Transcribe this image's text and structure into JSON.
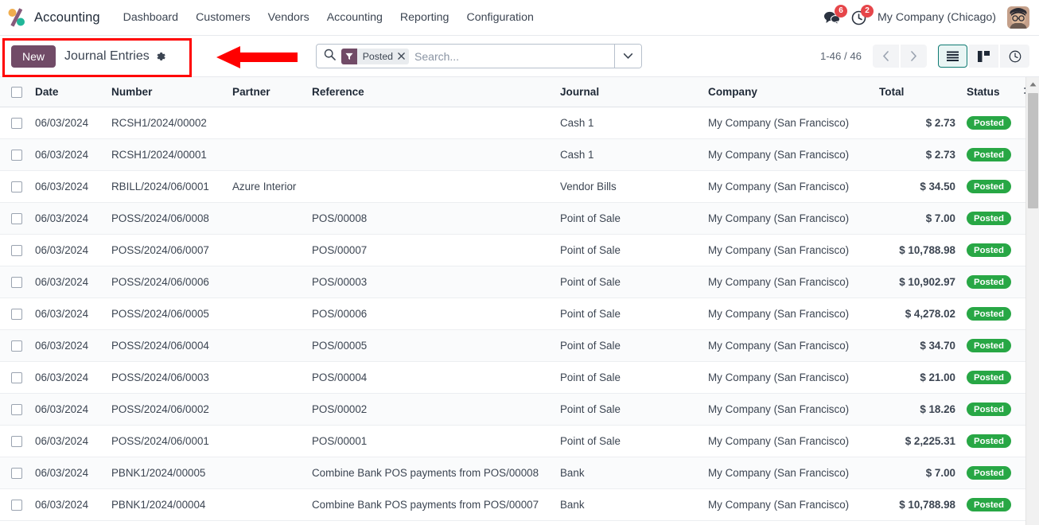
{
  "navbar": {
    "brand": "Accounting",
    "logo_colors": {
      "orange": "#f0ad4e",
      "purple": "#875a7b",
      "teal": "#21b799"
    },
    "menus": [
      {
        "label": "Dashboard"
      },
      {
        "label": "Customers"
      },
      {
        "label": "Vendors"
      },
      {
        "label": "Accounting"
      },
      {
        "label": "Reporting"
      },
      {
        "label": "Configuration"
      }
    ],
    "messages_badge": "6",
    "activities_badge": "2",
    "company": "My Company (Chicago)",
    "badge_color": "#e6464a"
  },
  "control_panel": {
    "new_button": "New",
    "title": "Journal Entries",
    "search": {
      "placeholder": "Search...",
      "facet_label": "Posted"
    },
    "pager": "1-46 / 46",
    "views": [
      {
        "name": "list",
        "active": true
      },
      {
        "name": "kanban",
        "active": false
      },
      {
        "name": "activity",
        "active": false
      }
    ]
  },
  "annotation": {
    "box_color": "#ff0000",
    "arrow_color": "#ff0000"
  },
  "table": {
    "columns": [
      {
        "key": "date",
        "label": "Date"
      },
      {
        "key": "number",
        "label": "Number"
      },
      {
        "key": "partner",
        "label": "Partner"
      },
      {
        "key": "reference",
        "label": "Reference"
      },
      {
        "key": "journal",
        "label": "Journal"
      },
      {
        "key": "company",
        "label": "Company"
      },
      {
        "key": "total",
        "label": "Total"
      },
      {
        "key": "status",
        "label": "Status"
      }
    ],
    "status_color": "#28a745",
    "rows": [
      {
        "date": "06/03/2024",
        "number": "RCSH1/2024/00002",
        "partner": "",
        "reference": "",
        "journal": "Cash 1",
        "company": "My Company (San Francisco)",
        "total": "$ 2.73",
        "status": "Posted"
      },
      {
        "date": "06/03/2024",
        "number": "RCSH1/2024/00001",
        "partner": "",
        "reference": "",
        "journal": "Cash 1",
        "company": "My Company (San Francisco)",
        "total": "$ 2.73",
        "status": "Posted"
      },
      {
        "date": "06/03/2024",
        "number": "RBILL/2024/06/0001",
        "partner": "Azure Interior",
        "reference": "",
        "journal": "Vendor Bills",
        "company": "My Company (San Francisco)",
        "total": "$ 34.50",
        "status": "Posted"
      },
      {
        "date": "06/03/2024",
        "number": "POSS/2024/06/0008",
        "partner": "",
        "reference": "POS/00008",
        "journal": "Point of Sale",
        "company": "My Company (San Francisco)",
        "total": "$ 7.00",
        "status": "Posted"
      },
      {
        "date": "06/03/2024",
        "number": "POSS/2024/06/0007",
        "partner": "",
        "reference": "POS/00007",
        "journal": "Point of Sale",
        "company": "My Company (San Francisco)",
        "total": "$ 10,788.98",
        "status": "Posted"
      },
      {
        "date": "06/03/2024",
        "number": "POSS/2024/06/0006",
        "partner": "",
        "reference": "POS/00003",
        "journal": "Point of Sale",
        "company": "My Company (San Francisco)",
        "total": "$ 10,902.97",
        "status": "Posted"
      },
      {
        "date": "06/03/2024",
        "number": "POSS/2024/06/0005",
        "partner": "",
        "reference": "POS/00006",
        "journal": "Point of Sale",
        "company": "My Company (San Francisco)",
        "total": "$ 4,278.02",
        "status": "Posted"
      },
      {
        "date": "06/03/2024",
        "number": "POSS/2024/06/0004",
        "partner": "",
        "reference": "POS/00005",
        "journal": "Point of Sale",
        "company": "My Company (San Francisco)",
        "total": "$ 34.70",
        "status": "Posted"
      },
      {
        "date": "06/03/2024",
        "number": "POSS/2024/06/0003",
        "partner": "",
        "reference": "POS/00004",
        "journal": "Point of Sale",
        "company": "My Company (San Francisco)",
        "total": "$ 21.00",
        "status": "Posted"
      },
      {
        "date": "06/03/2024",
        "number": "POSS/2024/06/0002",
        "partner": "",
        "reference": "POS/00002",
        "journal": "Point of Sale",
        "company": "My Company (San Francisco)",
        "total": "$ 18.26",
        "status": "Posted"
      },
      {
        "date": "06/03/2024",
        "number": "POSS/2024/06/0001",
        "partner": "",
        "reference": "POS/00001",
        "journal": "Point of Sale",
        "company": "My Company (San Francisco)",
        "total": "$ 2,225.31",
        "status": "Posted"
      },
      {
        "date": "06/03/2024",
        "number": "PBNK1/2024/00005",
        "partner": "",
        "reference": "Combine Bank POS payments from POS/00008",
        "journal": "Bank",
        "company": "My Company (San Francisco)",
        "total": "$ 7.00",
        "status": "Posted"
      },
      {
        "date": "06/03/2024",
        "number": "PBNK1/2024/00004",
        "partner": "",
        "reference": "Combine Bank POS payments from POS/00007",
        "journal": "Bank",
        "company": "My Company (San Francisco)",
        "total": "$ 10,788.98",
        "status": "Posted"
      }
    ]
  }
}
